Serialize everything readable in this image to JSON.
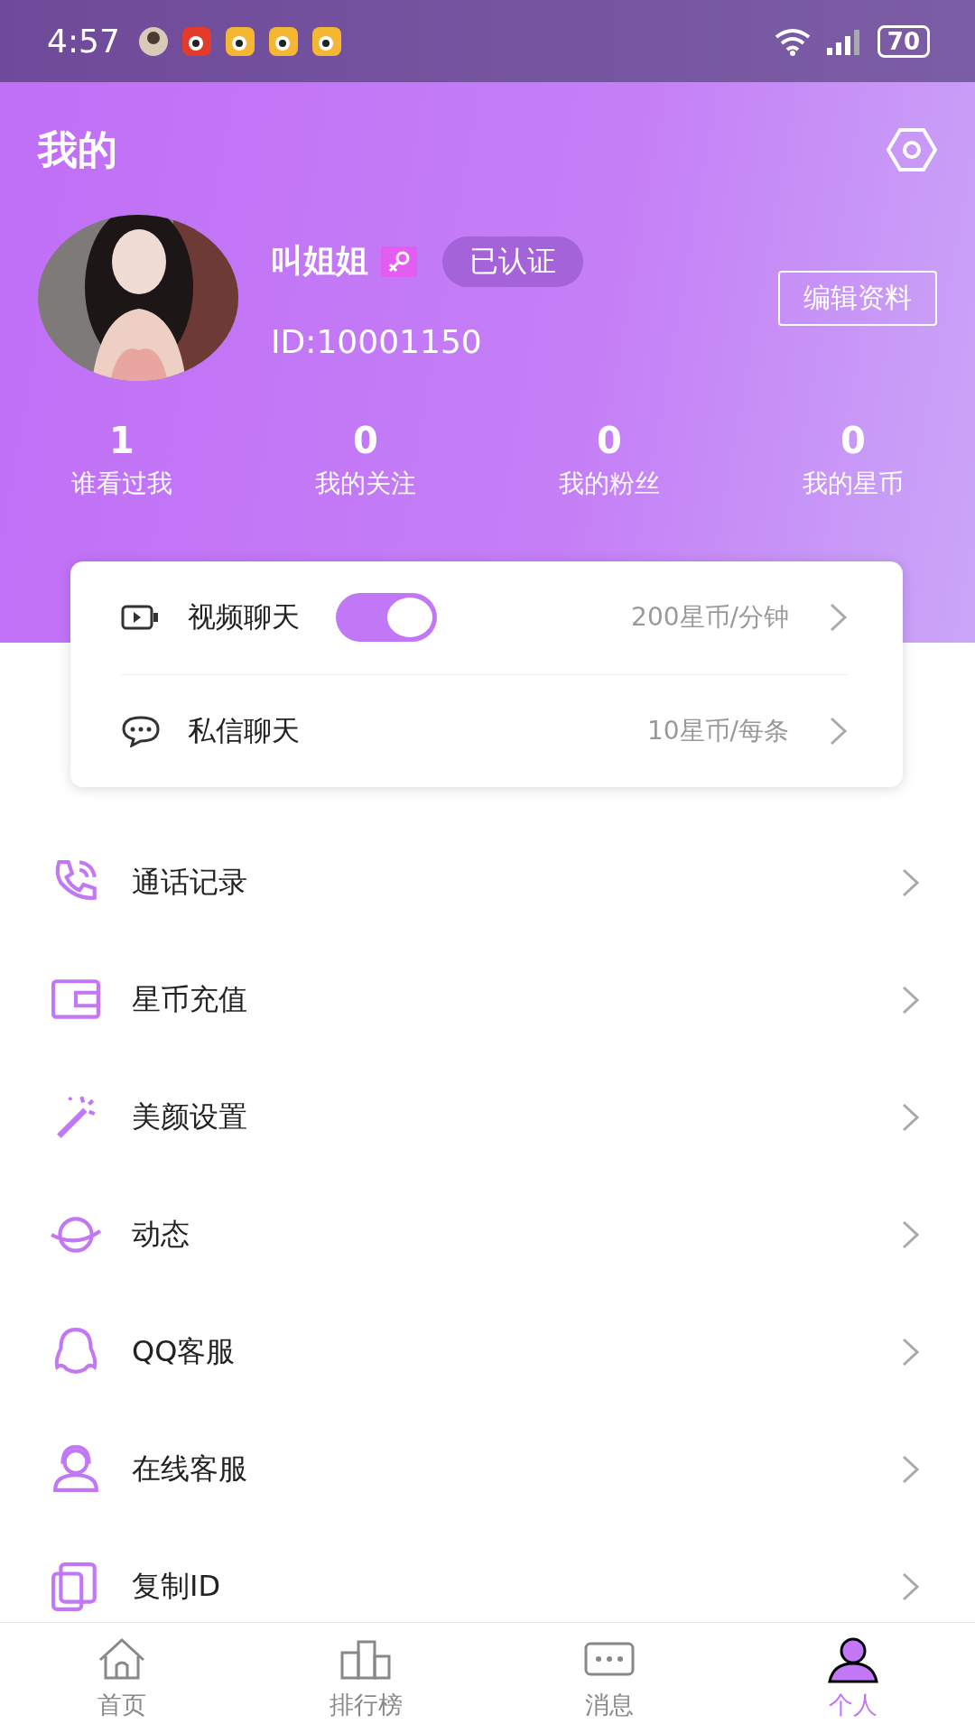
{
  "status_bar": {
    "time": "4:57",
    "battery": "70"
  },
  "header": {
    "title": "我的"
  },
  "profile": {
    "name": "叫姐姐",
    "verified": "已认证",
    "id": "ID:10001150",
    "edit_button": "编辑资料"
  },
  "stats": [
    {
      "value": "1",
      "label": "谁看过我"
    },
    {
      "value": "0",
      "label": "我的关注"
    },
    {
      "value": "0",
      "label": "我的粉丝"
    },
    {
      "value": "0",
      "label": "我的星币"
    }
  ],
  "chat_settings": [
    {
      "kind": "video",
      "label": "视频聊天",
      "on": true,
      "price": "200星币/分钟"
    },
    {
      "kind": "message",
      "label": "私信聊天",
      "price": "10星币/每条"
    }
  ],
  "menu": [
    {
      "kind": "phone",
      "label": "通话记录"
    },
    {
      "kind": "wallet",
      "label": "星币充值"
    },
    {
      "kind": "wand",
      "label": "美颜设置"
    },
    {
      "kind": "planet",
      "label": "动态"
    },
    {
      "kind": "qq",
      "label": "QQ客服"
    },
    {
      "kind": "agent",
      "label": "在线客服"
    },
    {
      "kind": "copy",
      "label": "复制ID"
    }
  ],
  "tabs": [
    {
      "kind": "home",
      "label": "首页",
      "selected": false
    },
    {
      "kind": "rank",
      "label": "排行榜",
      "selected": false
    },
    {
      "kind": "message",
      "label": "消息",
      "selected": false
    },
    {
      "kind": "person",
      "label": "个人",
      "selected": true
    }
  ]
}
